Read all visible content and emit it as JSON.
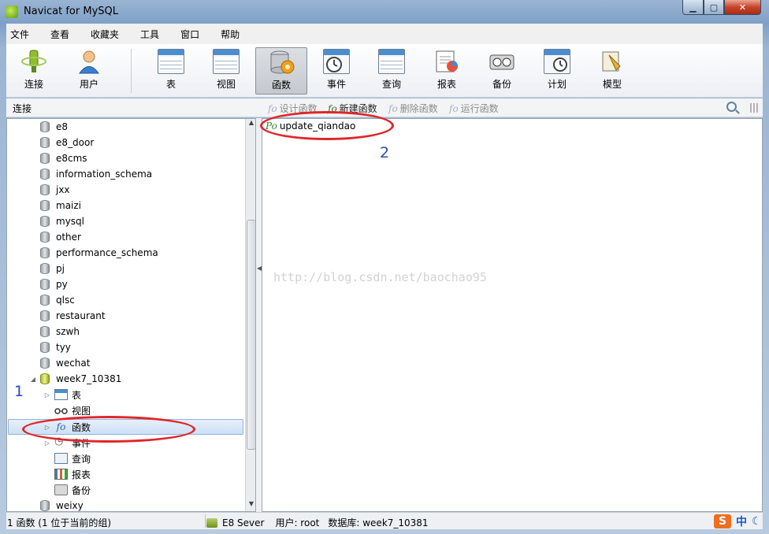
{
  "window": {
    "title": "Navicat for MySQL",
    "min": "▁",
    "max": "▢",
    "close": "✕"
  },
  "menu": [
    "文件",
    "查看",
    "收藏夹",
    "工具",
    "窗口",
    "帮助"
  ],
  "toolbar": {
    "connect": "连接",
    "user": "用户",
    "table": "表",
    "view": "视图",
    "function": "函数",
    "event": "事件",
    "query": "查询",
    "report": "报表",
    "backup": "备份",
    "schedule": "计划",
    "model": "模型"
  },
  "subbar": {
    "left_label": "连接",
    "design": "设计函数",
    "new": "新建函数",
    "delete": "删除函数",
    "run": "运行函数",
    "fx_design": "fo",
    "fx_new": "fo",
    "fx_delete": "fo",
    "fx_run": "fo"
  },
  "tree": {
    "databases": [
      "e8",
      "e8_door",
      "e8cms",
      "information_schema",
      "jxx",
      "maizi",
      "mysql",
      "other",
      "performance_schema",
      "pj",
      "py",
      "qlsc",
      "restaurant",
      "szwh",
      "tyy",
      "wechat"
    ],
    "open_db": "week7_10381",
    "children": [
      "表",
      "视图",
      "函数",
      "事件",
      "查询",
      "报表",
      "备份"
    ],
    "last_db": "weixy",
    "func_glyph": "fo"
  },
  "right": {
    "function_name": "update_qiandao",
    "function_glyph": "Po",
    "watermark": "http://blog.csdn.net/baochao95"
  },
  "annotations": {
    "one": "1",
    "two": "2"
  },
  "status": {
    "left": "1 函数 (1 位于当前的组)",
    "connection": "E8 Sever",
    "user": "用户: root",
    "database": "数据库: week7_10381",
    "ime_s": "S",
    "ime_zh": "中",
    "ime_moon": "☾"
  },
  "colors": {
    "annotation_red": "#e0262a",
    "annotation_blue": "#2b4bb5",
    "selected_row": "#cde0f5"
  }
}
